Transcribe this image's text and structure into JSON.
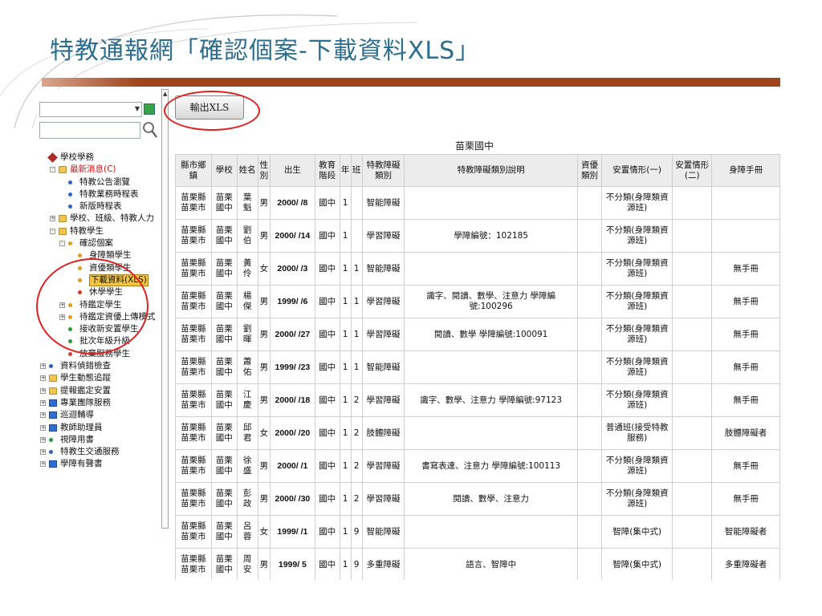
{
  "slide": {
    "title": "特教通報網「確認個案-下載資料XLS」"
  },
  "nav": {
    "select_value": "",
    "search_value": "",
    "icons": {
      "dropdown": "chevron-down-icon",
      "go": "go-icon",
      "search": "magnifier-icon"
    },
    "items": [
      {
        "label": "學校學務",
        "level": 0,
        "pm": "",
        "icon": "diamond",
        "style": ""
      },
      {
        "label": "最新消息(C)",
        "level": 1,
        "pm": "-",
        "icon": "folder",
        "style": "red"
      },
      {
        "label": "特教公告瀏覽",
        "level": 2,
        "pm": "",
        "icon": "dot",
        "style": ""
      },
      {
        "label": "特教業務時程表",
        "level": 2,
        "pm": "",
        "icon": "dot",
        "style": ""
      },
      {
        "label": "新版時程表",
        "level": 2,
        "pm": "",
        "icon": "dot",
        "style": ""
      },
      {
        "label": "學校、班級、特教人力",
        "level": 1,
        "pm": "+",
        "icon": "folder",
        "style": ""
      },
      {
        "label": "特教學生",
        "level": 1,
        "pm": "-",
        "icon": "folder",
        "style": ""
      },
      {
        "label": "確認個案",
        "level": 2,
        "pm": "-",
        "icon": "dot orange",
        "style": ""
      },
      {
        "label": "身障類學生",
        "level": 3,
        "pm": "",
        "icon": "dot orange",
        "style": ""
      },
      {
        "label": "資優類學生",
        "level": 3,
        "pm": "",
        "icon": "dot orange",
        "style": ""
      },
      {
        "label": "下載資料(XLS)",
        "level": 3,
        "pm": "",
        "icon": "dot orange",
        "style": "sel"
      },
      {
        "label": "休學學生",
        "level": 3,
        "pm": "",
        "icon": "dot red",
        "style": ""
      },
      {
        "label": "待鑑定學生",
        "level": 2,
        "pm": "+",
        "icon": "dot orange",
        "style": ""
      },
      {
        "label": "待鑑定資優上傳模式",
        "level": 2,
        "pm": "+",
        "icon": "dot orange",
        "style": ""
      },
      {
        "label": "接收新安置學生",
        "level": 2,
        "pm": "",
        "icon": "dot green",
        "style": ""
      },
      {
        "label": "批次年級升級",
        "level": 2,
        "pm": "",
        "icon": "dot green",
        "style": ""
      },
      {
        "label": "放棄服務學生",
        "level": 2,
        "pm": "",
        "icon": "dot red",
        "style": ""
      },
      {
        "label": "資料偵錯檢查",
        "level": 0,
        "pm": "+",
        "icon": "dot",
        "style": ""
      },
      {
        "label": "學生動態追蹤",
        "level": 0,
        "pm": "+",
        "icon": "folder",
        "style": ""
      },
      {
        "label": "提報鑑定安置",
        "level": 0,
        "pm": "+",
        "icon": "folder",
        "style": ""
      },
      {
        "label": "專業團隊服務",
        "level": 0,
        "pm": "+",
        "icon": "blue",
        "style": ""
      },
      {
        "label": "巡迴輔導",
        "level": 0,
        "pm": "+",
        "icon": "blue",
        "style": ""
      },
      {
        "label": "教師助理員",
        "level": 0,
        "pm": "+",
        "icon": "blue",
        "style": ""
      },
      {
        "label": "視障用書",
        "level": 0,
        "pm": "+",
        "icon": "dot green",
        "style": ""
      },
      {
        "label": "特教生交通服務",
        "level": 0,
        "pm": "+",
        "icon": "dot",
        "style": ""
      },
      {
        "label": "學障有聲書",
        "level": 0,
        "pm": "+",
        "icon": "blue",
        "style": ""
      }
    ]
  },
  "toolbar": {
    "export_label": "輸出XLS"
  },
  "school_caption": "苗栗國中",
  "table": {
    "headers": [
      "縣市鄉鎮",
      "學校",
      "姓名",
      "性別",
      "出生",
      "教育階段",
      "年",
      "班",
      "特教障礙類別",
      "特教障礙類別說明",
      "資優類別",
      "安置情形(一)",
      "安置情形(二)",
      "身障手冊"
    ],
    "rows": [
      [
        "苗栗縣苗栗市",
        "苗栗國中",
        "葉 魁",
        "男",
        "2000/ /8",
        "國中",
        "1",
        "",
        "智能障礙",
        "",
        "",
        "不分類(身障類資源班)",
        "",
        ""
      ],
      [
        "苗栗縣苗栗市",
        "苗栗國中",
        "劉 伯",
        "男",
        "2000/ /14",
        "國中",
        "1",
        "",
        "學習障礙",
        "學障編號：102185",
        "",
        "不分類(身障類資源班)",
        "",
        ""
      ],
      [
        "苗栗縣苗栗市",
        "苗栗國中",
        "黃 伶",
        "女",
        "2000/ /3",
        "國中",
        "1",
        "1",
        "智能障礙",
        "",
        "",
        "不分類(身障類資源班)",
        "",
        "無手冊"
      ],
      [
        "苗栗縣苗栗市",
        "苗栗國中",
        "楊 傑",
        "男",
        "1999/ /6",
        "國中",
        "1",
        "1",
        "學習障礙",
        "識字、閱讀、數學、注意力 學障編號:100296",
        "",
        "不分類(身障類資源班)",
        "",
        "無手冊"
      ],
      [
        "苗栗縣苗栗市",
        "苗栗國中",
        "劉 暉",
        "男",
        "2000/ /27",
        "國中",
        "1",
        "1",
        "學習障礙",
        "閱讀、數學 學障編號:100091",
        "",
        "不分類(身障類資源班)",
        "",
        "無手冊"
      ],
      [
        "苗栗縣苗栗市",
        "苗栗國中",
        "蕭 佑",
        "男",
        "1999/ /23",
        "國中",
        "1",
        "1",
        "智能障礙",
        "",
        "",
        "不分類(身障類資源班)",
        "",
        "無手冊"
      ],
      [
        "苗栗縣苗栗市",
        "苗栗國中",
        "江 慶",
        "男",
        "2000/ /18",
        "國中",
        "1",
        "2",
        "學習障礙",
        "識字、數學、注意力 學障編號:97123",
        "",
        "不分類(身障類資源班)",
        "",
        "無手冊"
      ],
      [
        "苗栗縣苗栗市",
        "苗栗國中",
        "邱 君",
        "女",
        "2000/ /20",
        "國中",
        "1",
        "2",
        "肢體障礙",
        "",
        "",
        "普通班(接受特教服務)",
        "",
        "肢體障礙者"
      ],
      [
        "苗栗縣苗栗市",
        "苗栗國中",
        "徐 盛",
        "男",
        "2000/ /1",
        "國中",
        "1",
        "2",
        "學習障礙",
        "書寫表達、注意力 學障編號:100113",
        "",
        "不分類(身障類資源班)",
        "",
        "無手冊"
      ],
      [
        "苗栗縣苗栗市",
        "苗栗國中",
        "彭 政",
        "男",
        "2000/ /30",
        "國中",
        "1",
        "2",
        "學習障礙",
        "閱讀、數學、注意力",
        "",
        "不分類(身障類資源班)",
        "",
        "無手冊"
      ],
      [
        "苗栗縣苗栗市",
        "苗栗國中",
        "呂 蓉",
        "女",
        "1999/ /1",
        "國中",
        "1",
        "9",
        "智能障礙",
        "",
        "",
        "智障(集中式)",
        "",
        "智能障礙者"
      ],
      [
        "苗栗縣苗栗市",
        "苗栗國中",
        "周 安",
        "男",
        "1999/ 5",
        "國中",
        "1",
        "9",
        "多重障礙",
        "語言、智障中",
        "",
        "智障(集中式)",
        "",
        "多重障礙者"
      ]
    ]
  },
  "annotations": {
    "color": "#e02020"
  },
  "colors": {
    "title": "#2d6e8e",
    "bar": "#a0441c",
    "selected": "#f5c542"
  }
}
